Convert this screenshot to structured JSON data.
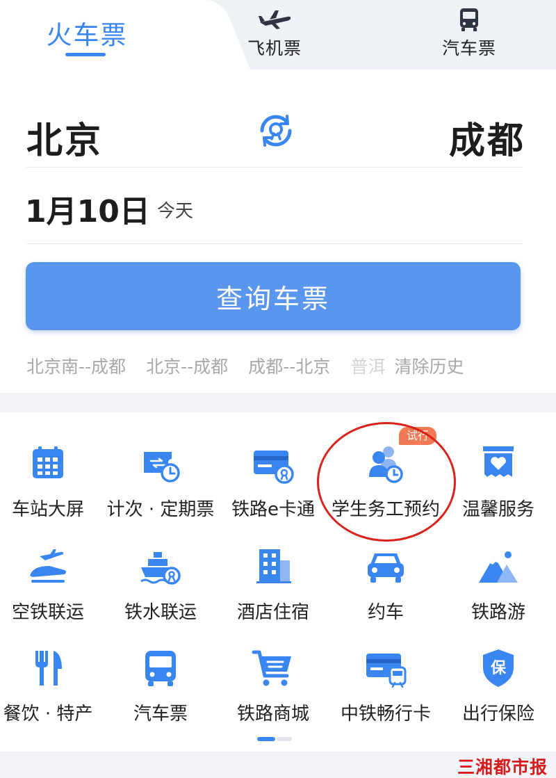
{
  "tabs": {
    "train": "火车票",
    "plane": "飞机票",
    "bus": "汽车票",
    "plane_icon": "airplane-icon",
    "bus_icon": "bus-icon"
  },
  "route": {
    "from": "北京",
    "to": "成都",
    "swap_icon": "swap-stations-icon"
  },
  "date": {
    "value": "1月10日",
    "note": "今天"
  },
  "search_button": "查询车票",
  "history": [
    "北京南--成都",
    "北京--成都",
    "成都--北京",
    "普洱"
  ],
  "clear_history": "清除历史",
  "services": [
    {
      "label": "车站大屏",
      "icon": "calendar-board-icon"
    },
    {
      "label": "计次 · 定期票",
      "icon": "ticket-clock-icon"
    },
    {
      "label": "铁路e卡通",
      "icon": "railway-card-icon"
    },
    {
      "label": "学生务工预约",
      "icon": "people-clock-icon",
      "badge": "试行"
    },
    {
      "label": "温馨服务",
      "icon": "heart-box-icon"
    },
    {
      "label": "空铁联运",
      "icon": "plane-train-icon"
    },
    {
      "label": "铁水联运",
      "icon": "ship-icon"
    },
    {
      "label": "酒店住宿",
      "icon": "hotel-icon"
    },
    {
      "label": "约车",
      "icon": "car-icon"
    },
    {
      "label": "铁路游",
      "icon": "mountain-icon"
    },
    {
      "label": "餐饮 · 特产",
      "icon": "fork-knife-icon"
    },
    {
      "label": "汽车票",
      "icon": "bus-icon"
    },
    {
      "label": "铁路商城",
      "icon": "cart-icon"
    },
    {
      "label": "中铁畅行卡",
      "icon": "card-train-icon"
    },
    {
      "label": "出行保险",
      "icon": "shield-icon"
    }
  ],
  "watermark": "三湘都市报",
  "colors": {
    "accent": "#3a86f0",
    "button": "#5b96ee",
    "badge": "#ef7a55",
    "circle": "#d9221b"
  }
}
